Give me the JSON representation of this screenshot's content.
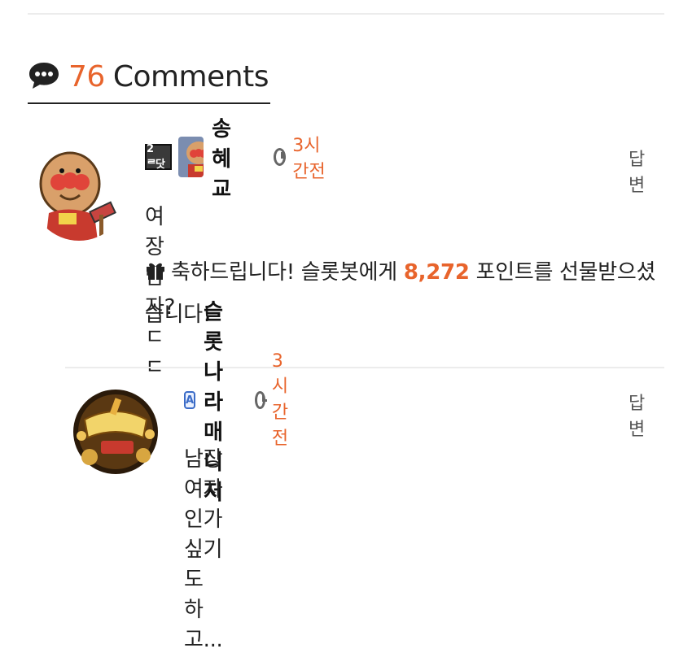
{
  "header": {
    "count": "76",
    "label": "Comments",
    "icon": "chat-bubble-icon"
  },
  "comments": [
    {
      "level_badge": "2ᄅ닷",
      "nickname": "송혜교",
      "time": "3시간전",
      "reply_label": "답변",
      "text": "여장남자? ㄷㄷ",
      "gift": {
        "prefix": "축하드립니다! 슬롯봇에게 ",
        "points": "8,272",
        "suffix": " 포인트를 선물받으셨습니다!"
      }
    },
    {
      "admin_badge": "A",
      "nickname": "슬롯나라매니저",
      "time": "3시간전",
      "reply_label": "답변",
      "text": "남장 여자인가 싶기도 하고..."
    }
  ],
  "colors": {
    "accent": "#e8642c",
    "text": "#222222",
    "divider": "#ececec"
  }
}
